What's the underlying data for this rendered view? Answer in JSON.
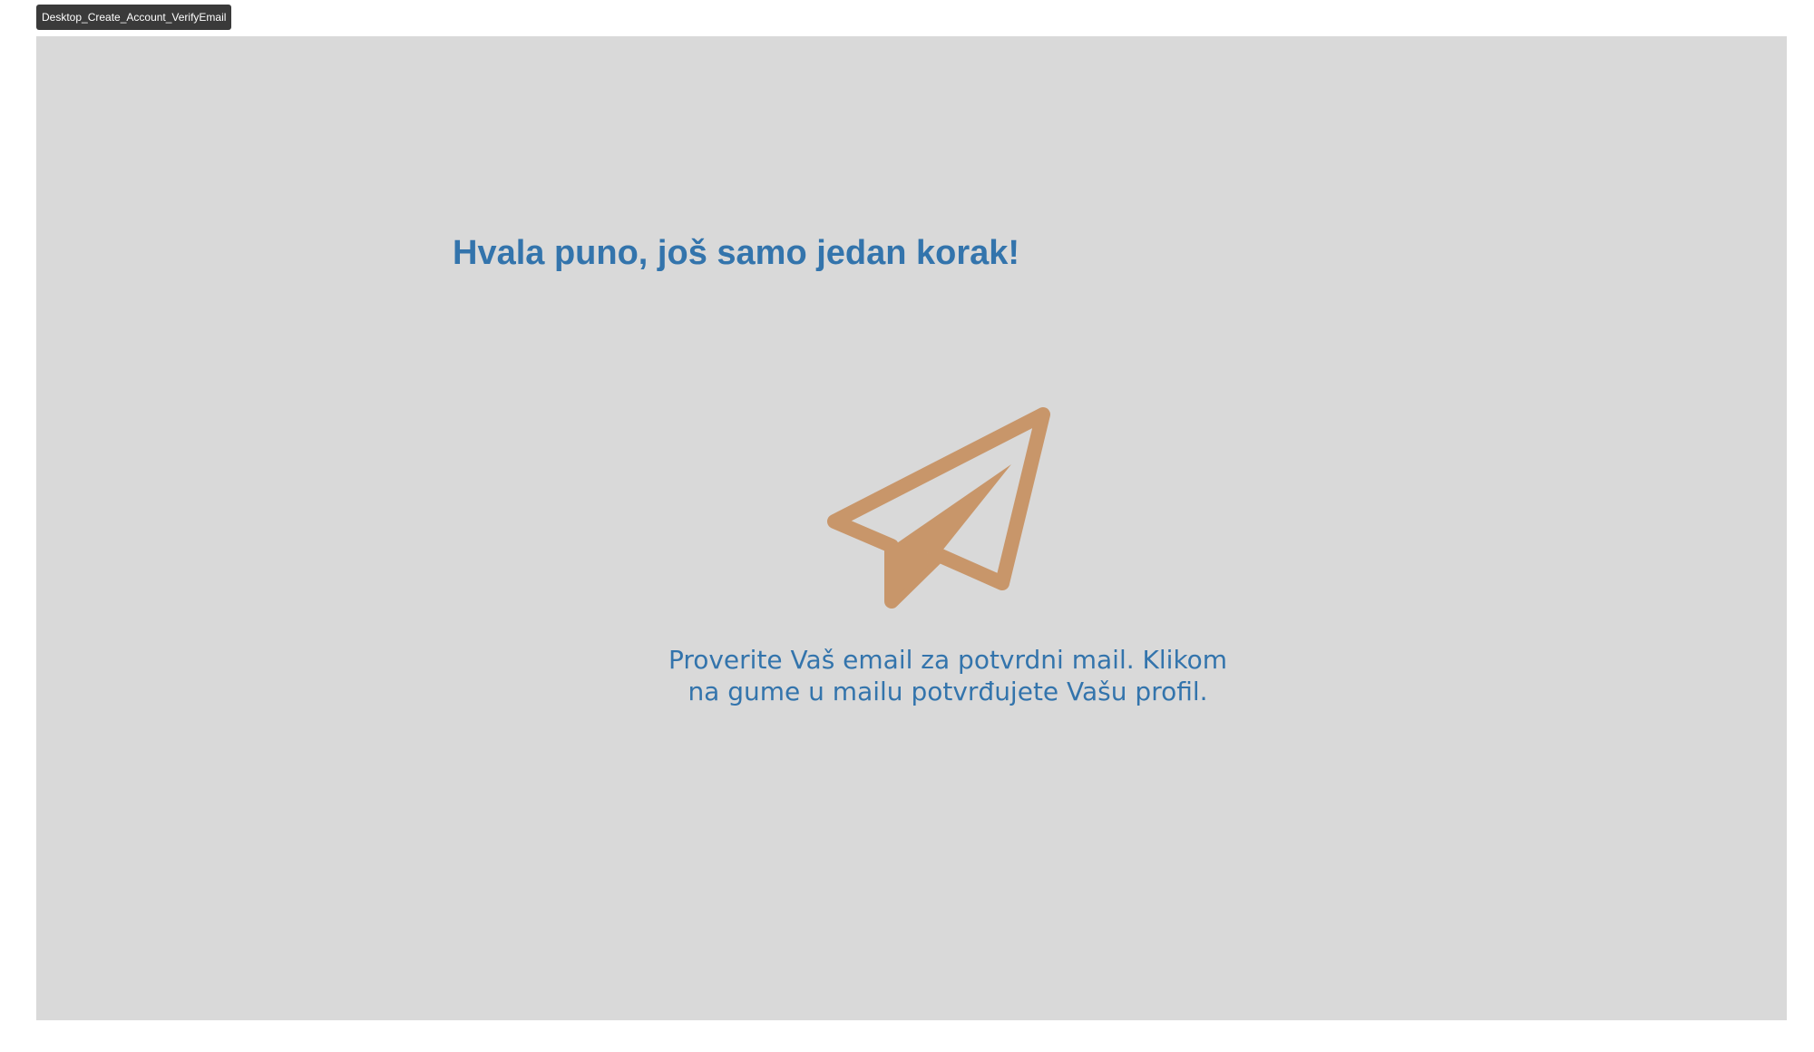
{
  "frame": {
    "label": "Desktop_Create_Account_VerifyEmail"
  },
  "verify": {
    "headline": "Hvala puno, još samo jedan korak!",
    "message_line1": "Proverite Vaš email za potvrdni mail. Klikom",
    "message_line2": "na gume u mailu potvrđujete Vašu profil.",
    "icon": "paper-plane-icon"
  },
  "colors": {
    "canvas_background": "#d9d9d9",
    "text_accent": "#3374ac",
    "icon_color": "#c8966a",
    "frame_tag_background": "#3a3a3a"
  }
}
